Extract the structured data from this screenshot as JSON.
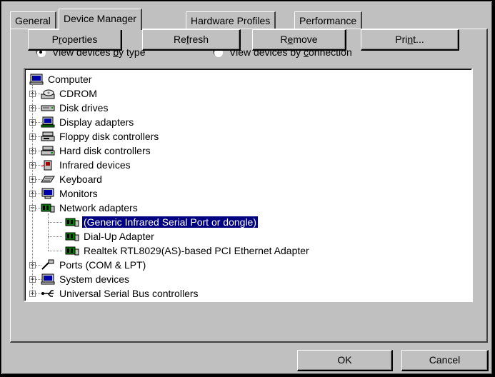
{
  "tabs": [
    "General",
    "Device Manager",
    "Hardware Profiles",
    "Performance"
  ],
  "view_options": {
    "by_type": {
      "prefix": "View devices ",
      "accel": "b",
      "suffix": "y type",
      "selected": true
    },
    "by_connection": {
      "prefix": "View devices by ",
      "accel": "c",
      "suffix": "onnection",
      "selected": false
    }
  },
  "tree": {
    "root": {
      "label": "Computer",
      "icon": "computer-icon"
    },
    "categories": [
      {
        "label": "CDROM",
        "icon": "cdrom-icon",
        "expanded": false
      },
      {
        "label": "Disk drives",
        "icon": "disk-drive-icon",
        "expanded": false
      },
      {
        "label": "Display adapters",
        "icon": "display-adapter-icon",
        "expanded": false
      },
      {
        "label": "Floppy disk controllers",
        "icon": "floppy-controller-icon",
        "expanded": false
      },
      {
        "label": "Hard disk controllers",
        "icon": "hard-disk-controller-icon",
        "expanded": false
      },
      {
        "label": "Infrared devices",
        "icon": "infrared-icon",
        "expanded": false
      },
      {
        "label": "Keyboard",
        "icon": "keyboard-icon",
        "expanded": false
      },
      {
        "label": "Monitors",
        "icon": "monitor-icon",
        "expanded": false
      },
      {
        "label": "Network adapters",
        "icon": "network-adapter-icon",
        "expanded": true,
        "children": [
          {
            "label": "(Generic Infrared Serial Port or dongle)",
            "icon": "network-card-icon",
            "selected": true
          },
          {
            "label": "Dial-Up Adapter",
            "icon": "network-card-icon",
            "selected": false
          },
          {
            "label": "Realtek RTL8029(AS)-based PCI Ethernet Adapter",
            "icon": "network-card-icon",
            "selected": false
          }
        ]
      },
      {
        "label": "Ports (COM & LPT)",
        "icon": "ports-icon",
        "expanded": false
      },
      {
        "label": "System devices",
        "icon": "system-devices-icon",
        "expanded": false
      },
      {
        "label": "Universal Serial Bus controllers",
        "icon": "usb-icon",
        "expanded": false
      }
    ]
  },
  "buttons": {
    "properties": {
      "pre": "P",
      "accel": "r",
      "post": "operties"
    },
    "refresh": {
      "pre": "Re",
      "accel": "f",
      "post": "resh"
    },
    "remove": {
      "pre": "R",
      "accel": "e",
      "post": "move"
    },
    "print": {
      "pre": "Pri",
      "accel": "n",
      "post": "t..."
    }
  },
  "footer": {
    "ok": "OK",
    "cancel": "Cancel"
  },
  "colors": {
    "face": "#c0c0c0",
    "selection": "#000080",
    "window": "#ffffff"
  }
}
